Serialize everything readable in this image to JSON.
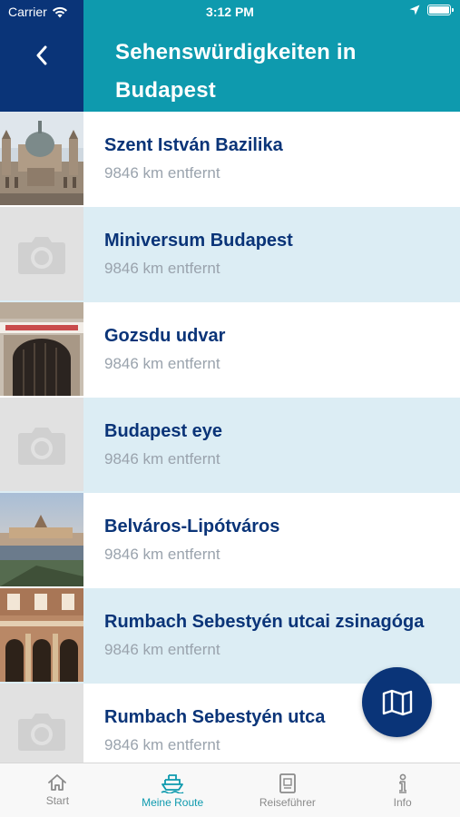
{
  "status_bar": {
    "carrier": "Carrier",
    "time": "3:12 PM"
  },
  "header": {
    "title": "Sehenswürdigkeiten in Budapest",
    "back_icon": "chevron-left-icon"
  },
  "colors": {
    "header_teal": "#0e9aae",
    "navy": "#0a3478",
    "alt_row": "#dcedf4",
    "distance_gray": "#9aa3ad"
  },
  "sights": [
    {
      "name": "Szent István Bazilika",
      "distance": "9846 km entfernt",
      "image": "basilica-photo"
    },
    {
      "name": "Miniversum Budapest",
      "distance": "9846 km entfernt",
      "image": "camera-placeholder-icon"
    },
    {
      "name": "Gozsdu udvar",
      "distance": "9846 km entfernt",
      "image": "gozsdu-gate-photo"
    },
    {
      "name": "Budapest eye",
      "distance": "9846 km entfernt",
      "image": "camera-placeholder-icon"
    },
    {
      "name": "Belváros-Lipótváros",
      "distance": "9846 km entfernt",
      "image": "parliament-photo"
    },
    {
      "name": "Rumbach Sebestyén utcai zsinagóga",
      "distance": "9846 km entfernt",
      "image": "synagogue-photo"
    },
    {
      "name": "Rumbach Sebestyén utca",
      "distance": "9846 km entfernt",
      "image": "camera-placeholder-icon"
    }
  ],
  "map_button": {
    "icon": "map-icon"
  },
  "tabs": [
    {
      "label": "Start",
      "icon": "home-icon",
      "active": false
    },
    {
      "label": "Meine Route",
      "icon": "ship-icon",
      "active": true
    },
    {
      "label": "Reiseführer",
      "icon": "book-icon",
      "active": false
    },
    {
      "label": "Info",
      "icon": "info-icon",
      "active": false
    }
  ]
}
